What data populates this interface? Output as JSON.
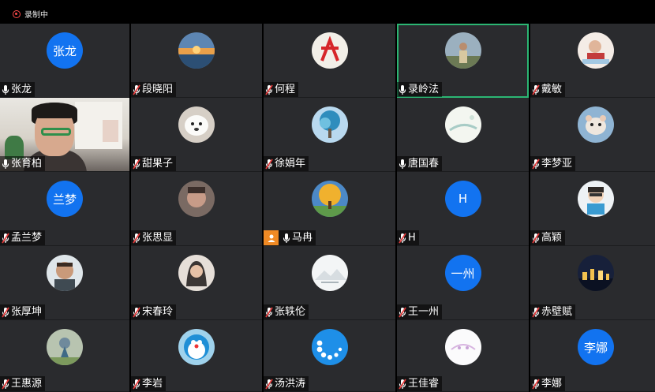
{
  "recording": {
    "label": "录制中"
  },
  "colors": {
    "avatar_blue": "#1273f0",
    "active_border": "#2bb673",
    "tile_bg": "#2a2b2e",
    "muted_red": "#e23b3b",
    "host_orange": "#f08a24"
  },
  "participants": [
    {
      "name": "张龙",
      "avatar_text": "张龙",
      "avatar": "text",
      "mic": "on"
    },
    {
      "name": "段晓阳",
      "avatar": "photo-sunset-sea",
      "mic": "muted"
    },
    {
      "name": "何程",
      "avatar": "photo-red-logo",
      "mic": "muted"
    },
    {
      "name": "录岭法",
      "avatar": "photo-person-outdoor",
      "mic": "on",
      "active": true
    },
    {
      "name": "戴敏",
      "avatar": "photo-child-drawing",
      "mic": "muted"
    },
    {
      "name": "张育柏",
      "avatar": "video",
      "mic": "on"
    },
    {
      "name": "甜果子",
      "avatar": "photo-white-dog",
      "mic": "muted"
    },
    {
      "name": "徐娟年",
      "avatar": "photo-tree-blue",
      "mic": "muted"
    },
    {
      "name": "唐国春",
      "avatar": "photo-pale-green",
      "mic": "on"
    },
    {
      "name": "李梦亚",
      "avatar": "photo-hamster",
      "mic": "muted"
    },
    {
      "name": "孟兰梦",
      "avatar_text": "兰梦",
      "avatar": "text",
      "mic": "muted"
    },
    {
      "name": "张思显",
      "avatar": "photo-face-dark",
      "mic": "muted"
    },
    {
      "name": "马冉",
      "avatar": "photo-autumn-tree",
      "mic": "on",
      "host": true
    },
    {
      "name": "H",
      "avatar_text": "H",
      "avatar": "text",
      "mic": "muted"
    },
    {
      "name": "高颖",
      "avatar": "photo-cartoon-boy",
      "mic": "muted"
    },
    {
      "name": "张厚坤",
      "avatar": "photo-man-smiling",
      "mic": "muted"
    },
    {
      "name": "宋春玲",
      "avatar": "photo-woman-dark",
      "mic": "muted"
    },
    {
      "name": "张轶伦",
      "avatar": "photo-misty-mountain",
      "mic": "muted"
    },
    {
      "name": "王一州",
      "avatar_text": "一州",
      "avatar": "text",
      "mic": "muted"
    },
    {
      "name": "赤壁赋",
      "avatar": "photo-night-city",
      "mic": "muted"
    },
    {
      "name": "王惠源",
      "avatar": "photo-painting",
      "mic": "muted"
    },
    {
      "name": "李岩",
      "avatar": "photo-doraemon",
      "mic": "muted"
    },
    {
      "name": "汤洪涛",
      "avatar": "photo-blue-loader",
      "mic": "muted"
    },
    {
      "name": "王佳睿",
      "avatar": "photo-white-sketch",
      "mic": "muted"
    },
    {
      "name": "李娜",
      "avatar_text": "李娜",
      "avatar": "text",
      "mic": "muted"
    }
  ]
}
